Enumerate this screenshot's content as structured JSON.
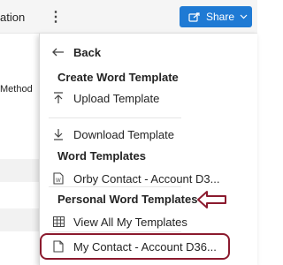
{
  "toolbar": {
    "cut_text": "ation",
    "more_label": "⋮",
    "share_label": "Share"
  },
  "background": {
    "method_text": "Method"
  },
  "menu": {
    "back_label": "Back",
    "create_header": "Create Word Template",
    "upload_label": "Upload Template",
    "download_label": "Download Template",
    "word_templates_header": "Word Templates",
    "orby_label": "Orby Contact - Account D3...",
    "personal_header": "Personal Word Templates",
    "view_all_label": "View All My Templates",
    "my_contact_label": "My Contact - Account D36..."
  },
  "colors": {
    "share_bg": "#1f7ad4",
    "annotation": "#8b1a2e"
  }
}
